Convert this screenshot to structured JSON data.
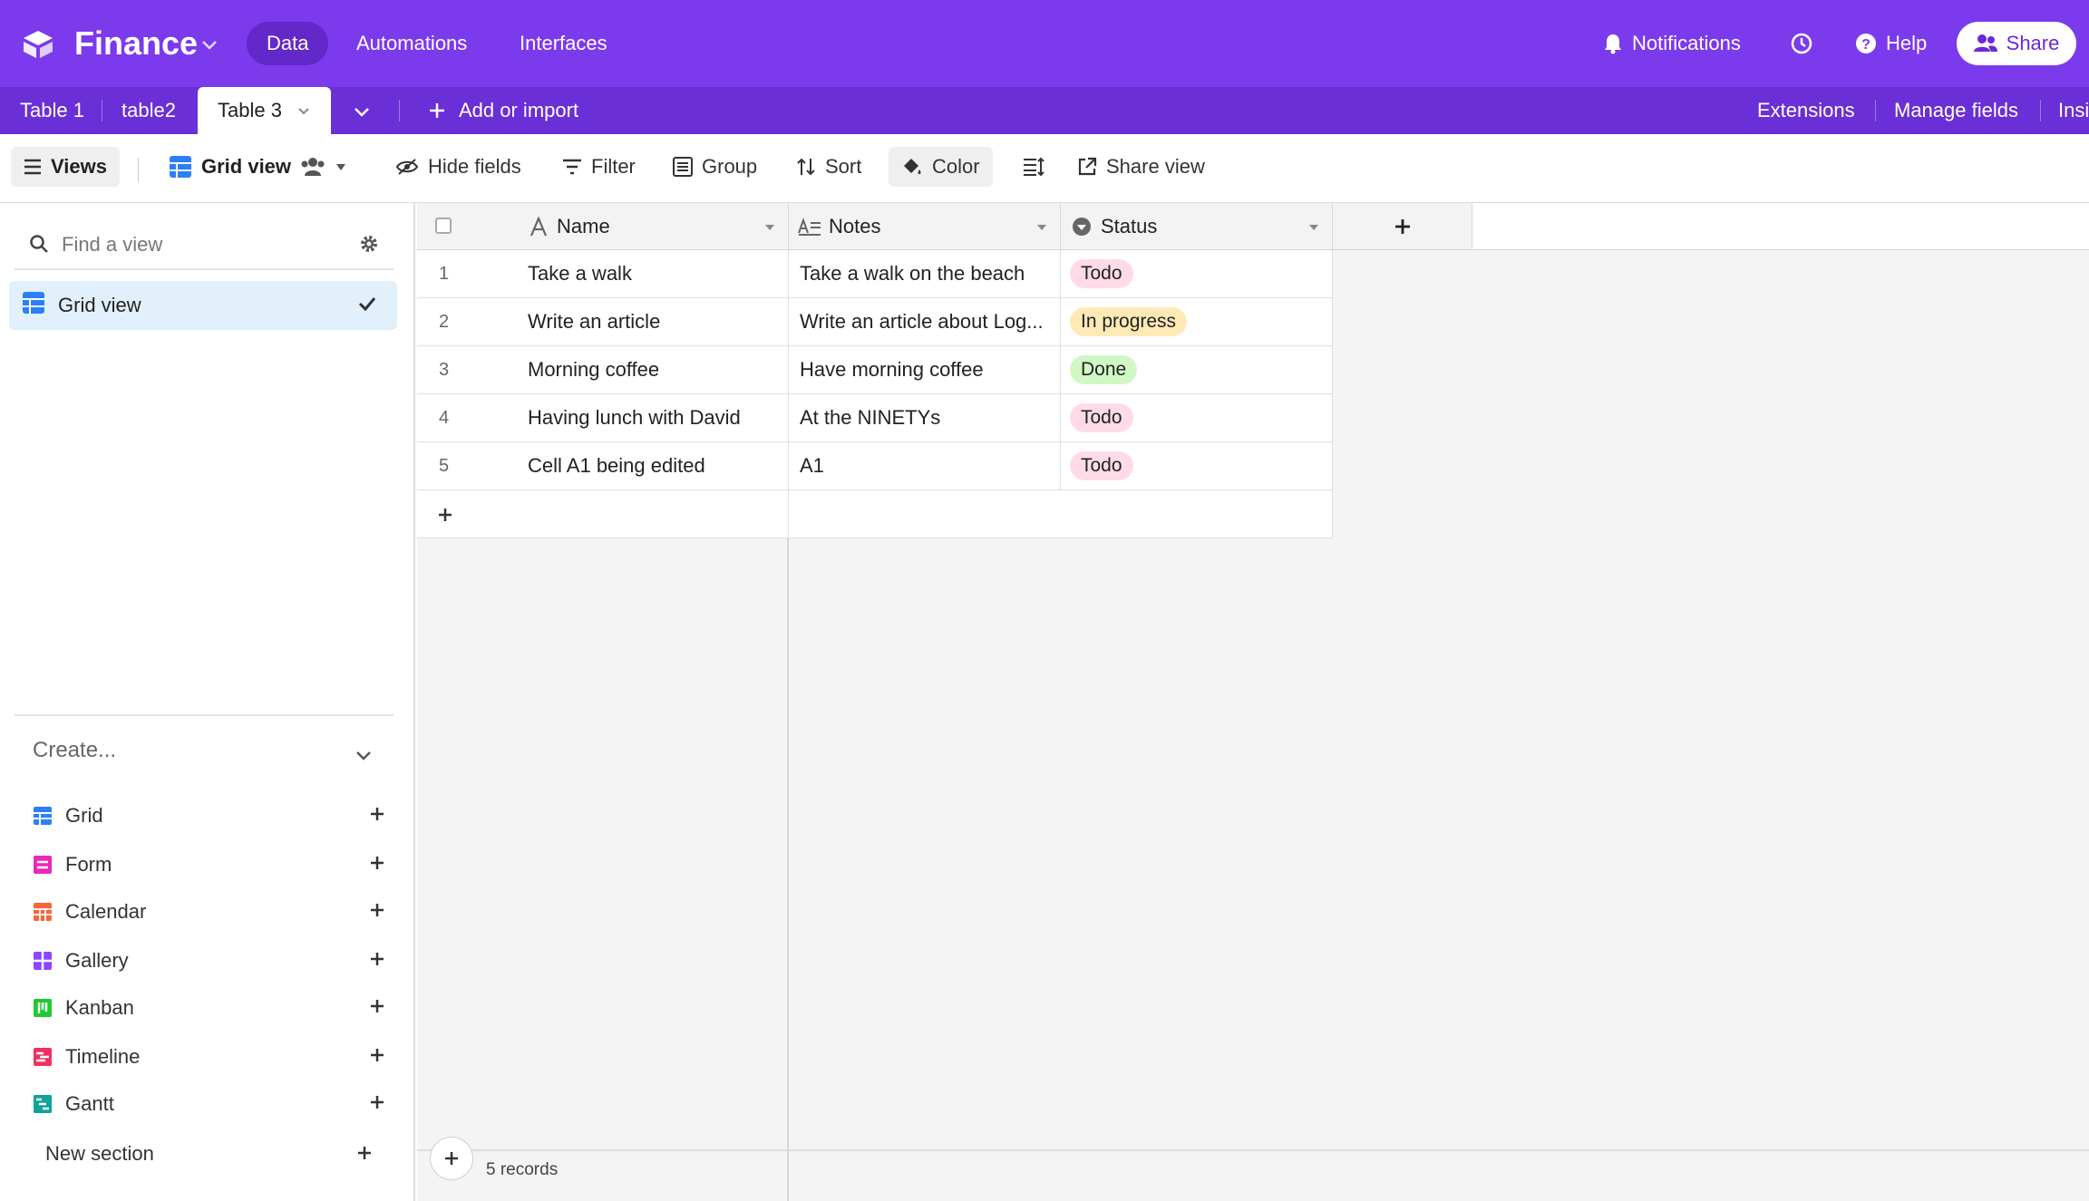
{
  "topbar": {
    "base_name": "Finance",
    "nav": [
      "Data",
      "Automations",
      "Interfaces"
    ],
    "notifications_label": "Notifications",
    "help_label": "Help",
    "share_label": "Share",
    "accent_color": "#7c3aed"
  },
  "tabs": {
    "tables": [
      "Table 1",
      "table2",
      "Table 3"
    ],
    "add_label": "Add or import",
    "right": [
      "Extensions",
      "Manage fields",
      "Insi"
    ]
  },
  "toolbar": {
    "views": "Views",
    "current_view": "Grid view",
    "hide_fields": "Hide fields",
    "filter": "Filter",
    "group": "Group",
    "sort": "Sort",
    "color": "Color",
    "share_view": "Share view"
  },
  "sidebar": {
    "search_placeholder": "Find a view",
    "views": [
      {
        "label": "Grid view",
        "icon": "grid-icon"
      }
    ],
    "create_label": "Create...",
    "create_items": [
      {
        "label": "Grid",
        "color": "#2d7ff9"
      },
      {
        "label": "Form",
        "color": "#e929ba"
      },
      {
        "label": "Calendar",
        "color": "#f7653b"
      },
      {
        "label": "Gallery",
        "color": "#8b46ff"
      },
      {
        "label": "Kanban",
        "color": "#20c933"
      },
      {
        "label": "Timeline",
        "color": "#ef3061"
      },
      {
        "label": "Gantt",
        "color": "#18bfff"
      }
    ],
    "new_section": "New section"
  },
  "grid": {
    "columns": [
      "Name",
      "Notes",
      "Status"
    ],
    "rows": [
      {
        "num": "1",
        "name": "Take a walk",
        "notes": "Take a walk on the beach",
        "status": "Todo"
      },
      {
        "num": "2",
        "name": "Write an article",
        "notes": "Write an article about Log...",
        "status": "In progress"
      },
      {
        "num": "3",
        "name": "Morning coffee",
        "notes": "Have morning coffee",
        "status": "Done"
      },
      {
        "num": "4",
        "name": "Having lunch with David",
        "notes": "At the NINETYs",
        "status": "Todo"
      },
      {
        "num": "5",
        "name": "Cell A1 being edited",
        "notes": "A1",
        "status": "Todo"
      }
    ],
    "status_colors": {
      "Todo": "#ffdce5",
      "In progress": "#ffeab6",
      "Done": "#d1f7c4"
    },
    "records_label": "5 records"
  }
}
